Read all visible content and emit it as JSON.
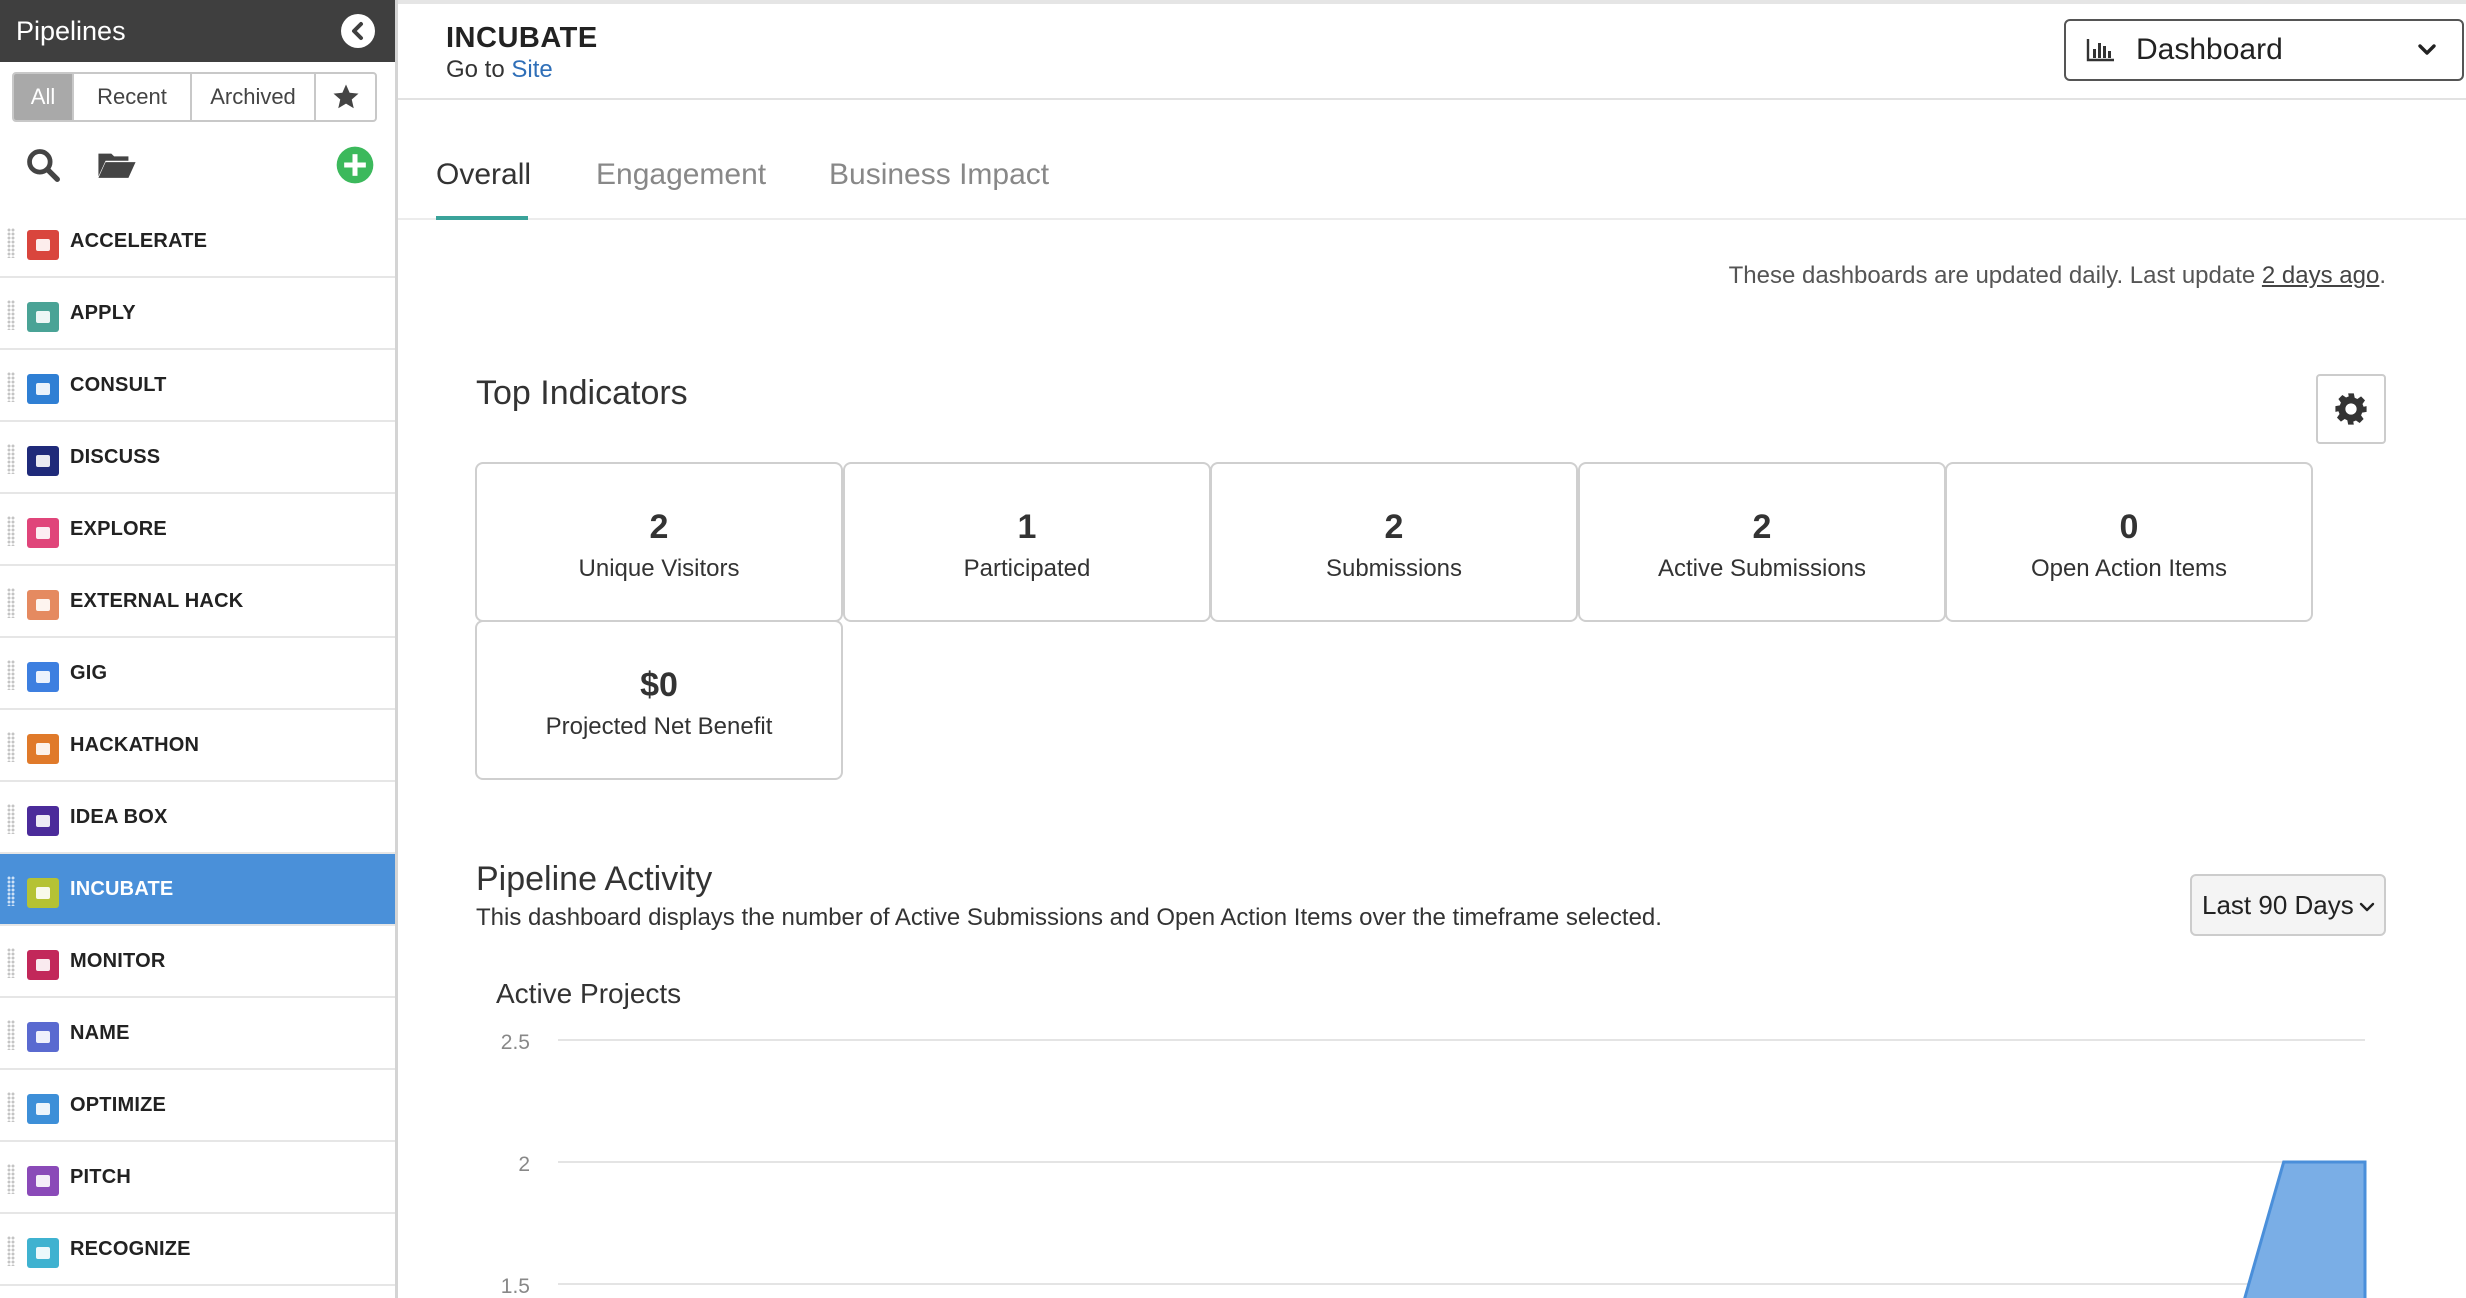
{
  "sidebar": {
    "title": "Pipelines",
    "filters": [
      {
        "label": "All",
        "active": true
      },
      {
        "label": "Recent",
        "active": false
      },
      {
        "label": "Archived",
        "active": false
      }
    ],
    "tools": {
      "search_icon": "search-icon",
      "folder_icon": "folder-open-icon",
      "add_icon": "plus-circle-icon",
      "favorite_icon": "star-icon"
    },
    "items": [
      {
        "label": "ACCELERATE",
        "color": "#d9453d",
        "active": false
      },
      {
        "label": "APPLY",
        "color": "#4aa396",
        "active": false
      },
      {
        "label": "CONSULT",
        "color": "#2f7fd4",
        "active": false
      },
      {
        "label": "DISCUSS",
        "color": "#1f2a7a",
        "active": false
      },
      {
        "label": "EXPLORE",
        "color": "#e0457a",
        "active": false
      },
      {
        "label": "EXTERNAL HACK",
        "color": "#e58a60",
        "active": false
      },
      {
        "label": "GIG",
        "color": "#3d7fe0",
        "active": false
      },
      {
        "label": "HACKATHON",
        "color": "#e07a2a",
        "active": false
      },
      {
        "label": "IDEA BOX",
        "color": "#4b2b9a",
        "active": false
      },
      {
        "label": "INCUBATE",
        "color": "#b5c234",
        "active": true
      },
      {
        "label": "MONITOR",
        "color": "#c2285a",
        "active": false
      },
      {
        "label": "NAME",
        "color": "#5a6ad0",
        "active": false
      },
      {
        "label": "OPTIMIZE",
        "color": "#3d8fd8",
        "active": false
      },
      {
        "label": "PITCH",
        "color": "#8a4ab8",
        "active": false
      },
      {
        "label": "RECOGNIZE",
        "color": "#3fb2d0",
        "active": false
      }
    ]
  },
  "header": {
    "title": "INCUBATE",
    "goto_prefix": "Go to",
    "goto_link": "Site",
    "view_select": "Dashboard"
  },
  "tabs": [
    {
      "label": "Overall",
      "active": true
    },
    {
      "label": "Engagement",
      "active": false
    },
    {
      "label": "Business Impact",
      "active": false
    }
  ],
  "notice": {
    "text": "These dashboards are updated daily. Last update ",
    "link": "2 days ago",
    "suffix": "."
  },
  "top_indicators": {
    "title": "Top Indicators",
    "cards": [
      {
        "value": "2",
        "label": "Unique Visitors"
      },
      {
        "value": "1",
        "label": "Participated"
      },
      {
        "value": "2",
        "label": "Submissions"
      },
      {
        "value": "2",
        "label": "Active Submissions"
      },
      {
        "value": "0",
        "label": "Open Action Items"
      },
      {
        "value": "$0",
        "label": "Projected Net Benefit"
      }
    ]
  },
  "pipeline_activity": {
    "title": "Pipeline Activity",
    "description": "This dashboard displays the number of Active Submissions and Open Action Items over the timeframe selected.",
    "range_select": "Last 90 Days"
  },
  "chart_data": {
    "type": "area",
    "title": "Active Projects",
    "xlabel": "",
    "ylabel": "",
    "yticks": [
      "2.5",
      "2",
      "1.5"
    ],
    "ylim": [
      1.5,
      2.5
    ],
    "grid": true,
    "series": [
      {
        "color": "#7aaee6",
        "x": [
          0.0,
          0.93,
          0.955,
          1.0
        ],
        "values": [
          0,
          0,
          2,
          2
        ]
      }
    ]
  }
}
